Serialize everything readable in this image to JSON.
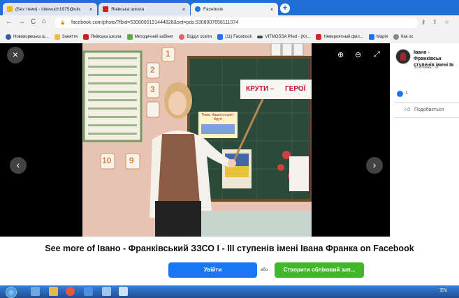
{
  "tabs": [
    {
      "title": "(Без теми) - lokevuch1975@ukr.",
      "color": "#f5b900",
      "active": false
    },
    {
      "title": "Янівська школа",
      "color": "#d21f25",
      "active": false
    },
    {
      "title": "Facebook",
      "color": "#1877f2",
      "active": true
    }
  ],
  "new_tab_label": "+",
  "nav": {
    "back": "←",
    "forward": "→",
    "reload": "C",
    "home": "⌂"
  },
  "address": {
    "url": "facebook.com/photo/?fbid=5308000191444828&set=pcb.5308007658111074"
  },
  "bookmarks": [
    {
      "label": "Нововорвська ш...",
      "color": "#3a5b9a"
    },
    {
      "label": "Заняття",
      "color": "#f1c232"
    },
    {
      "label": "Янівська школа",
      "color": "#d21f25"
    },
    {
      "label": "Методичний кабінет",
      "color": "#6aa84f"
    },
    {
      "label": "Відділ освіти",
      "color": "#e06666"
    },
    {
      "label": "(11) Facebook",
      "color": "#1877f2"
    },
    {
      "label": "VITMOSSA Plied - (Кл...",
      "color": "#444444"
    },
    {
      "label": "Невероятный фил...",
      "color": "#e02020"
    },
    {
      "label": "Марія",
      "color": "#1877f2"
    },
    {
      "label": "Как ос",
      "color": "#888888"
    }
  ],
  "viewer": {
    "close_icon": "×",
    "prev_icon": "‹",
    "next_icon": "›",
    "zoom_in_icon": "⊕",
    "zoom_out_icon": "⊖",
    "fullscreen_icon": "⤢"
  },
  "photo": {
    "board_text_1": "КРУТИ –",
    "board_text_2": "ГЕРОЇ",
    "poster_text": "Тема: Наша історія - Круті",
    "digits": [
      "1",
      "2",
      "3",
      "10",
      "9"
    ]
  },
  "post": {
    "page_name": "Івано - Франківськ ступенів імені Ів",
    "date": "30 січень · ⊘",
    "reactions_count": "1",
    "like_label": "Подобається"
  },
  "prompt": {
    "see_more": "See more of Івано - Франківський ЗЗСО І - ІІІ ступенів імені Івана Франка on Facebook",
    "login": "Увійти",
    "or": "або",
    "signup": "Створити обліковий зап..."
  },
  "taskbar": {
    "lang": "EN"
  }
}
